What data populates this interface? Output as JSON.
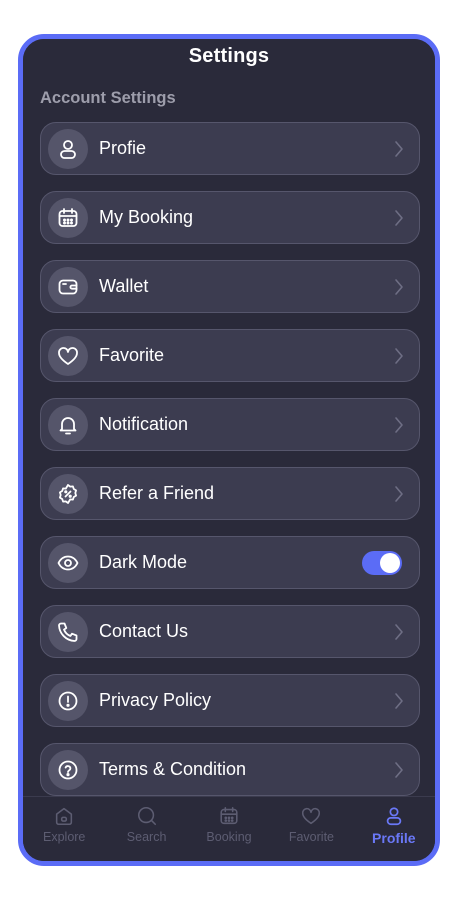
{
  "header": {
    "title": "Settings"
  },
  "section": {
    "label": "Account Settings"
  },
  "menu": {
    "items": [
      {
        "label": "Profie",
        "icon": "user-icon"
      },
      {
        "label": "My Booking",
        "icon": "calendar-icon"
      },
      {
        "label": "Wallet",
        "icon": "wallet-icon"
      },
      {
        "label": "Favorite",
        "icon": "heart-icon"
      },
      {
        "label": "Notification",
        "icon": "bell-icon"
      },
      {
        "label": "Refer a Friend",
        "icon": "discount-icon"
      },
      {
        "label": "Dark Mode",
        "icon": "eye-icon",
        "toggle": true
      },
      {
        "label": "Contact Us",
        "icon": "phone-icon"
      },
      {
        "label": "Privacy Policy",
        "icon": "info-icon"
      },
      {
        "label": "Terms & Condition",
        "icon": "question-icon"
      }
    ]
  },
  "tabbar": {
    "tabs": [
      {
        "label": "Explore",
        "icon": "home-icon"
      },
      {
        "label": "Search",
        "icon": "search-icon"
      },
      {
        "label": "Booking",
        "icon": "calendar-icon"
      },
      {
        "label": "Favorite",
        "icon": "heart-icon"
      },
      {
        "label": "Profile",
        "icon": "user-icon",
        "active": true
      }
    ]
  },
  "colors": {
    "accent": "#5b6cf6",
    "background": "#2a2a3a",
    "card": "#3c3c50",
    "inactive_tab": "#5d5d72"
  }
}
